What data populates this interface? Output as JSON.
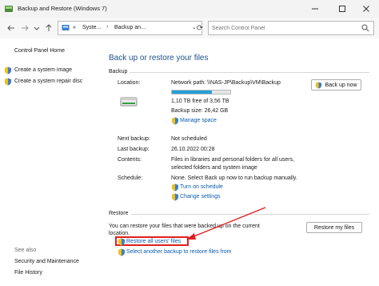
{
  "window": {
    "title": "Backup and Restore (Windows 7)",
    "minimize_icon": "minimize-icon",
    "maximize_icon": "maximize-icon",
    "close_icon": "close-icon"
  },
  "addressbar": {
    "segments": [
      "«",
      "Syste...",
      "Backup an..."
    ],
    "search_placeholder": "Search Control Panel"
  },
  "sidebar": {
    "home": "Control Panel Home",
    "links": [
      "Create a system image",
      "Create a system repair disc"
    ],
    "see_also_title": "See also",
    "see_also": [
      "Security and Maintenance",
      "File History"
    ]
  },
  "main": {
    "heading": "Back up or restore your files",
    "backup": {
      "section": "Backup",
      "location_label": "Location:",
      "location_value": "Network path: \\\\NAS-JP\\Backup\\VM\\Backup",
      "free_space": "1,10 TB free of 3,56 TB",
      "usage_fraction": 0.69,
      "backup_size": "Backup size: 26,42 GB",
      "manage_space": "Manage space",
      "backup_now": "Back up now",
      "next_backup_label": "Next backup:",
      "next_backup_value": "Not scheduled",
      "last_backup_label": "Last backup:",
      "last_backup_value": "26.10.2022 00:28",
      "contents_label": "Contents:",
      "contents_value_1": "Files in libraries and personal folders for all users,",
      "contents_value_2": "selected folders and system image",
      "schedule_label": "Schedule:",
      "schedule_value": "None. Select Back up now to run backup manually.",
      "turn_on_schedule": "Turn on schedule",
      "change_settings": "Change settings"
    },
    "restore": {
      "section": "Restore",
      "text_1": "You can restore your files that were backed up on the current",
      "text_2": "location.",
      "restore_my_files": "Restore my files",
      "restore_all_users": "Restore all users' files",
      "select_another": "Select another backup to restore files from"
    }
  },
  "colors": {
    "heading": "#1e4e8c",
    "link": "#0b5cad",
    "progress": "#26a0da",
    "highlight": "#e02020"
  }
}
